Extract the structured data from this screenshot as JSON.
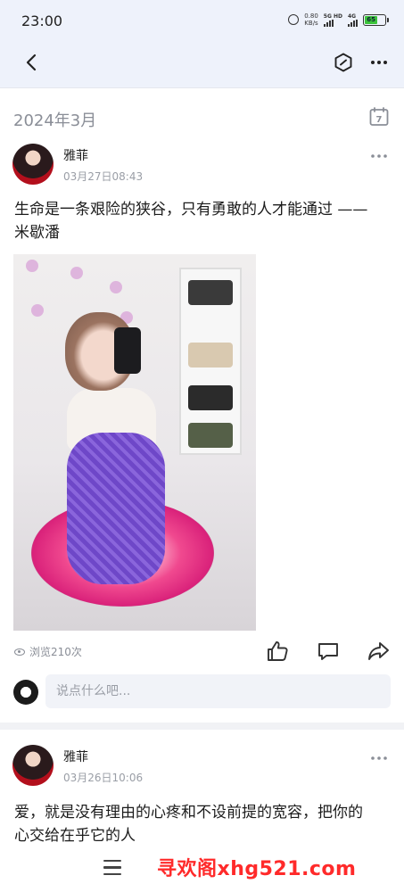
{
  "status_bar": {
    "time": "23:00",
    "net_speed_value": "0.80",
    "net_speed_unit": "KB/s",
    "sig1_label": "5G HD",
    "sig2_label": "4G",
    "battery": "65"
  },
  "nav": {
    "back_icon": "chevron-left-icon",
    "hex_icon": "hexagon-icon",
    "more_icon": "more-dots-icon"
  },
  "month_header": {
    "label": "2024年3月",
    "calendar_day": "7"
  },
  "posts": [
    {
      "author": "雅菲",
      "time": "03月27日08:43",
      "content": "生命是一条艰险的狭谷，只有勇敢的人才能通过 ——米歇潘",
      "views": "浏览210次"
    },
    {
      "author": "雅菲",
      "time": "03月26日10:06",
      "content": "爱，就是没有理由的心疼和不设前提的宽容，把你的心交给在乎它的人"
    }
  ],
  "comment": {
    "placeholder": "说点什么吧..."
  },
  "bottom": {
    "watermark": "寻欢阁xhg521.com"
  },
  "colors": {
    "header_bg": "#eef2fb",
    "watermark": "#ff2a2a",
    "muted": "#8a8e97"
  }
}
